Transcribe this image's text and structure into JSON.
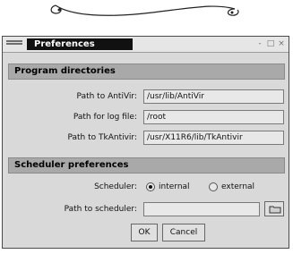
{
  "window": {
    "title": "Preferences",
    "controls": [
      "-",
      "□",
      "×"
    ]
  },
  "program_directories": {
    "header": "Program directories",
    "rows": [
      {
        "label": "Path to AntiVir:",
        "value": "/usr/lib/AntiVir"
      },
      {
        "label": "Path for log file:",
        "value": "/root"
      },
      {
        "label": "Path to TkAntivir:",
        "value": "/usr/X11R6/lib/TkAntivir"
      }
    ]
  },
  "scheduler_preferences": {
    "header": "Scheduler preferences",
    "scheduler_label": "Scheduler:",
    "options": [
      {
        "label": "internal",
        "selected": true
      },
      {
        "label": "external",
        "selected": false
      }
    ],
    "path_label": "Path to scheduler:",
    "path_value": ""
  },
  "buttons": {
    "ok": "OK",
    "cancel": "Cancel"
  },
  "icons": [
    "window-menu-icon",
    "folder-icon"
  ]
}
